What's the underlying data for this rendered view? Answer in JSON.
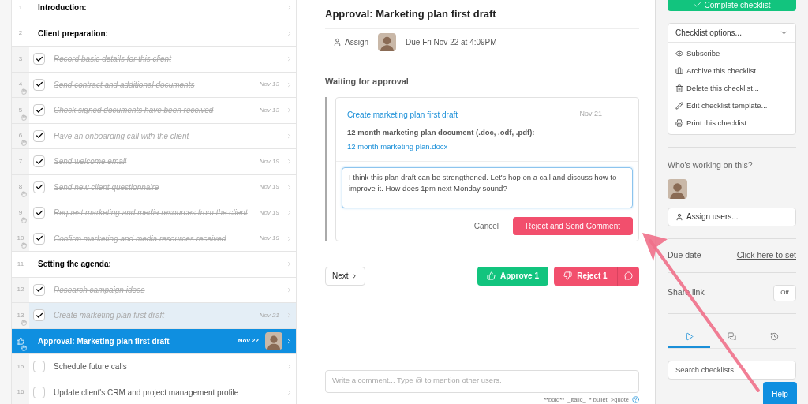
{
  "checklist": {
    "rows": [
      {
        "kind": "heading",
        "number": "1",
        "title": "Introduction:",
        "selected": false,
        "highlighted": false,
        "grab": false
      },
      {
        "kind": "heading",
        "number": "2",
        "title": "Client preparation:",
        "selected": false,
        "highlighted": false,
        "grab": false
      },
      {
        "kind": "task",
        "number": "3",
        "title": "Record basic details for this client",
        "checked": true,
        "selected": false,
        "highlighted": false,
        "grab": false
      },
      {
        "kind": "task",
        "number": "4",
        "title": "Send contract and additional documents",
        "date": "Nov 13",
        "checked": true,
        "selected": false,
        "highlighted": false,
        "grab": true
      },
      {
        "kind": "task",
        "number": "5",
        "title": "Check signed documents have been received",
        "date": "Nov 13",
        "checked": true,
        "selected": false,
        "highlighted": false,
        "grab": true
      },
      {
        "kind": "task",
        "number": "6",
        "title": "Have an onboarding call with the client",
        "checked": true,
        "selected": false,
        "highlighted": false,
        "grab": true
      },
      {
        "kind": "task",
        "number": "7",
        "title": "Send welcome email",
        "date": "Nov 19",
        "checked": true,
        "selected": false,
        "highlighted": false,
        "grab": false
      },
      {
        "kind": "task",
        "number": "8",
        "title": "Send new client questionnaire",
        "date": "Nov 19",
        "checked": true,
        "selected": false,
        "highlighted": false,
        "grab": true
      },
      {
        "kind": "task",
        "number": "9",
        "title": "Request marketing and media resources from the client",
        "date": "Nov 19",
        "checked": true,
        "selected": false,
        "highlighted": false,
        "grab": true
      },
      {
        "kind": "task",
        "number": "10",
        "title": "Confirm marketing and media resources received",
        "date": "Nov 19",
        "checked": true,
        "selected": false,
        "highlighted": false,
        "grab": true
      },
      {
        "kind": "heading",
        "number": "11",
        "title": "Setting the agenda:",
        "selected": false,
        "highlighted": false,
        "grab": false
      },
      {
        "kind": "task",
        "number": "12",
        "title": "Research campaign ideas",
        "checked": true,
        "selected": false,
        "highlighted": false,
        "grab": false
      },
      {
        "kind": "task",
        "number": "13",
        "title": "Create marketing plan first draft",
        "date": "Nov 21",
        "checked": true,
        "selected": false,
        "highlighted": true,
        "grab": true
      },
      {
        "kind": "approval",
        "title": "Approval: Marketing plan first draft",
        "date": "Nov 22",
        "selected": true,
        "highlighted": false,
        "grab": true
      },
      {
        "kind": "task",
        "number": "15",
        "title": "Schedule future calls",
        "checked": false,
        "selected": false,
        "highlighted": false,
        "grab": false
      },
      {
        "kind": "task",
        "number": "16",
        "title": "Update client's CRM and project management profile",
        "checked": false,
        "selected": false,
        "highlighted": false,
        "grab": false
      }
    ]
  },
  "detail": {
    "title": "Approval: Marketing plan first draft",
    "assign": "Assign",
    "due": "Due Fri Nov 22 at 4:09PM",
    "section": "Waiting for approval",
    "card": {
      "link": "Create marketing plan first draft",
      "date": "Nov 21",
      "field_label": "12 month marketing plan document (.doc, .odf, .pdf):",
      "file": "12 month marketing plan.docx",
      "comment": "I think this plan draft can be strengthened. Let's hop on a call and discuss how to improve it. How does 1pm next Monday sound?",
      "cancel": "Cancel",
      "reject_send": "Reject and Send Comment"
    },
    "next": "Next",
    "approve": "Approve 1",
    "reject": "Reject 1",
    "comment_placeholder": "Write a comment... Type @ to mention other users.",
    "format_hint": "**bold**  _italic_  * bullet  >quote"
  },
  "sidebar": {
    "complete": "Complete checklist",
    "options": "Checklist options...",
    "menu": [
      "Subscribe",
      "Archive this checklist",
      "Delete this checklist...",
      "Edit checklist template...",
      "Print this checklist..."
    ],
    "working": "Who's working on this?",
    "assign_users": "Assign users...",
    "due_label": "Due date",
    "due_value": "Click here to set",
    "share_label": "Share link",
    "share_state": "Off",
    "tabs": [
      {
        "kind": "run",
        "selected": true
      },
      {
        "kind": "comments",
        "selected": false
      },
      {
        "kind": "history",
        "selected": false
      }
    ],
    "search_placeholder": "Search checklists",
    "help": "Help"
  }
}
